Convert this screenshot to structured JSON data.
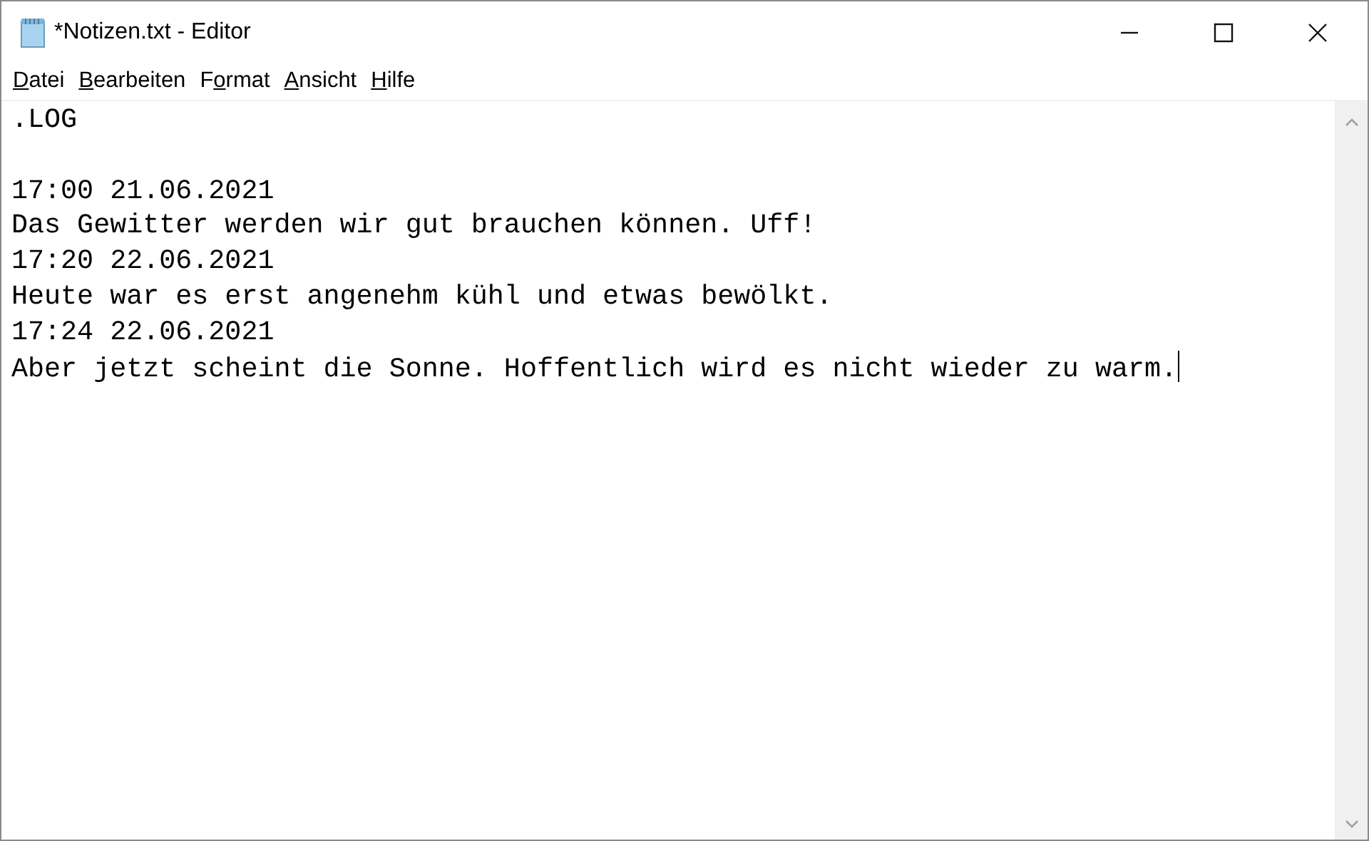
{
  "window": {
    "title": "*Notizen.txt - Editor"
  },
  "menu": [
    {
      "key": "D",
      "rest": "atei"
    },
    {
      "key": "B",
      "rest": "earbeiten"
    },
    {
      "pre": "F",
      "key": "o",
      "rest": "rmat"
    },
    {
      "key": "A",
      "rest": "nsicht"
    },
    {
      "key": "H",
      "rest": "ilfe"
    }
  ],
  "editor": {
    "content": ".LOG\n\n17:00 21.06.2021\nDas Gewitter werden wir gut brauchen können. Uff!\n17:20 22.06.2021\nHeute war es erst angenehm kühl und etwas bewölkt.\n17:24 22.06.2021\nAber jetzt scheint die Sonne. Hoffentlich wird es nicht wieder zu warm.",
    "caret": true
  }
}
